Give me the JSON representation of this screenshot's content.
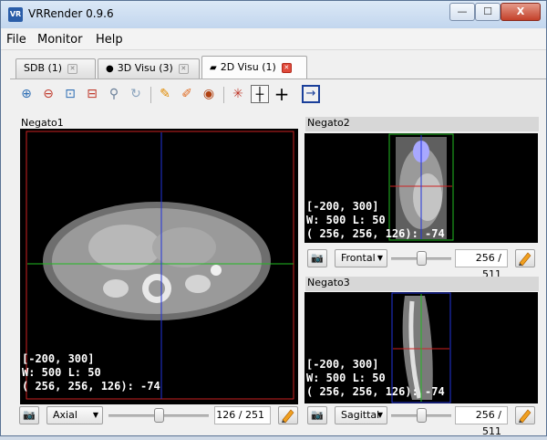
{
  "window": {
    "title": "VRRender 0.9.6",
    "icon": "VR",
    "min_glyph": "—",
    "max_glyph": "☐",
    "close_glyph": "X"
  },
  "menu": [
    "File",
    "Monitor",
    "Help"
  ],
  "tabs": [
    {
      "label": "SDB (1)",
      "icon": "",
      "active": false
    },
    {
      "label": "3D Visu (3)",
      "icon": "eye-icon",
      "active": false
    },
    {
      "label": "2D Visu (1)",
      "icon": "slices-icon",
      "active": true
    }
  ],
  "toolbar": {
    "icons": [
      "zoom-in-icon",
      "zoom-out-icon",
      "zoom-region-icon",
      "zoom-reset-icon",
      "magnifier-icon",
      "rotate-icon",
      "pencil-icon",
      "eraser-icon",
      "eye-icon",
      "crosshair-hide-icon",
      "crosshair-dash-icon",
      "crosshair-full-icon",
      "export-icon"
    ]
  },
  "views": {
    "negato1": {
      "label": "Negato1",
      "window": "[-200, 300]",
      "wl": "W: 500 L: 50",
      "coord": "( 256, 256, 126): -74",
      "orientation": "Axial",
      "slice": "126 / 251",
      "slider_fraction": 0.5
    },
    "negato2": {
      "label": "Negato2",
      "window": "[-200, 300]",
      "wl": "W: 500 L: 50",
      "coord": "( 256, 256, 126): -74",
      "orientation": "Frontal",
      "slice": "256 / 511",
      "slider_fraction": 0.5
    },
    "negato3": {
      "label": "Negato3",
      "window": "[-200, 300]",
      "wl": "W: 500 L: 50",
      "coord": "( 256, 256, 126): -74",
      "orientation": "Sagittal",
      "slice": "256 / 511",
      "slider_fraction": 0.5
    }
  },
  "colors": {
    "crosshair_red": "#cc2222",
    "crosshair_blue": "#2233dd",
    "crosshair_green": "#22bb22",
    "overlay_text": "#ffffff"
  }
}
